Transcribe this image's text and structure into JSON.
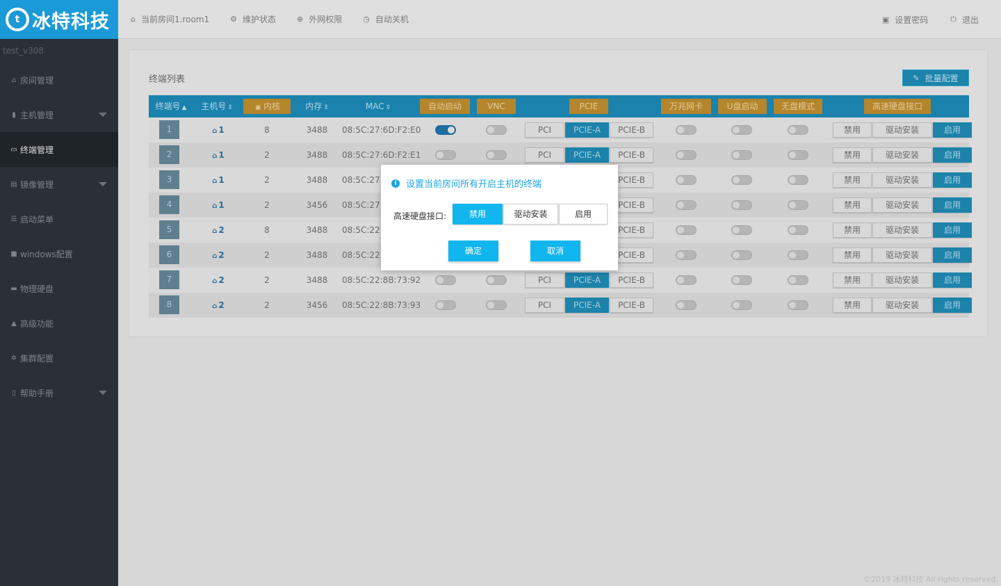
{
  "logo": {
    "mark": "t",
    "text": "冰特科技"
  },
  "version": "test_v308",
  "nav": [
    {
      "label": "房间管理",
      "icon": "home-icon",
      "glyph": "⌂",
      "caret": false,
      "active": false
    },
    {
      "label": "主机管理",
      "icon": "server-icon",
      "glyph": "▮",
      "caret": true,
      "active": false
    },
    {
      "label": "终端管理",
      "icon": "monitor-icon",
      "glyph": "▭",
      "caret": false,
      "active": true
    },
    {
      "label": "镜像管理",
      "icon": "disk-image-icon",
      "glyph": "▤",
      "caret": true,
      "active": false
    },
    {
      "label": "启动菜单",
      "icon": "list-icon",
      "glyph": "☰",
      "caret": false,
      "active": false
    },
    {
      "label": "windows配置",
      "icon": "windows-icon",
      "glyph": "■",
      "caret": false,
      "active": false
    },
    {
      "label": "物理硬盘",
      "icon": "hard-drive-icon",
      "glyph": "▬",
      "caret": false,
      "active": false
    },
    {
      "label": "高级功能",
      "icon": "warning-icon",
      "glyph": "▲",
      "caret": false,
      "active": false
    },
    {
      "label": "集群配置",
      "icon": "gear-icon",
      "glyph": "✲",
      "caret": false,
      "active": false
    },
    {
      "label": "帮助手册",
      "icon": "book-icon",
      "glyph": "▯",
      "caret": true,
      "active": false
    }
  ],
  "header": {
    "room": "当前房间1.room1",
    "maintenance": "维护状态",
    "network": "外网权限",
    "shutdown": "自动关机",
    "set_password": "设置密码",
    "logout": "退出"
  },
  "panel": {
    "title": "终端列表",
    "batch_button": "批量配置"
  },
  "columns": {
    "terminal_no": "终端号",
    "host_no": "主机号",
    "cores": "内核",
    "memory": "内存",
    "mac": "MAC",
    "auto_start": "自动启动",
    "vnc": "VNC",
    "pcie": "PCIE",
    "ten_gig_nic": "万兆网卡",
    "usb_boot": "U盘启动",
    "diskless_mode": "无盘模式",
    "high_speed_disk": "高速硬盘接口"
  },
  "pcie_options": [
    "PCI",
    "PCIE-A",
    "PCIE-B"
  ],
  "disk_options": [
    "禁用",
    "驱动安装",
    "启用"
  ],
  "rows": [
    {
      "id": "1",
      "host": "1",
      "cores": "8",
      "memory": "3488",
      "mac": "08:5C:27:6D:F2:E0",
      "auto_start": true
    },
    {
      "id": "2",
      "host": "1",
      "cores": "2",
      "memory": "3488",
      "mac": "08:5C:27:6D:F2:E1",
      "auto_start": false
    },
    {
      "id": "3",
      "host": "1",
      "cores": "2",
      "memory": "3488",
      "mac": "08:5C:27:",
      "auto_start": false
    },
    {
      "id": "4",
      "host": "1",
      "cores": "2",
      "memory": "3456",
      "mac": "08:5C:27:",
      "auto_start": false
    },
    {
      "id": "5",
      "host": "2",
      "cores": "8",
      "memory": "3488",
      "mac": "08:5C:22:",
      "auto_start": false
    },
    {
      "id": "6",
      "host": "2",
      "cores": "2",
      "memory": "3488",
      "mac": "08:5C:22:",
      "auto_start": false
    },
    {
      "id": "7",
      "host": "2",
      "cores": "2",
      "memory": "3488",
      "mac": "08:5C:22:8B:73:92",
      "auto_start": false
    },
    {
      "id": "8",
      "host": "2",
      "cores": "2",
      "memory": "3456",
      "mac": "08:5C:22:8B:73:93",
      "auto_start": false
    }
  ],
  "dialog": {
    "title": "设置当前房间所有开启主机的终端",
    "label": "高速硬盘接口:",
    "options": [
      "禁用",
      "驱动安装",
      "启用"
    ],
    "selected": "禁用",
    "confirm": "确定",
    "cancel": "取消"
  },
  "footer": "©2019 冰特科技 All rights reserved.",
  "colors": {
    "brand": "#1a9ad7",
    "accent": "#12b6ee",
    "table_header": "#1a82ad",
    "orange_header": "#b4852b"
  }
}
